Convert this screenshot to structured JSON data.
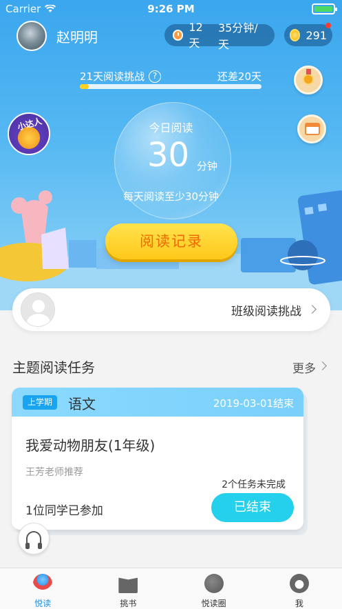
{
  "status_bar": {
    "carrier": "Carrier",
    "time": "9:26 PM"
  },
  "header": {
    "username": "赵明明",
    "streak_days": "12天",
    "daily_goal": "35分钟/天",
    "coins": "291"
  },
  "challenge": {
    "label": "21天阅读挑战",
    "help_symbol": "?",
    "remaining": "还差20天",
    "progress_fraction": 0.05
  },
  "mascot": {
    "text": "小达人"
  },
  "today": {
    "label": "今日阅读",
    "minutes": "30",
    "unit": "分钟",
    "hint": "每天阅读至少30分钟"
  },
  "record_button": "阅读记录",
  "class_challenge": {
    "label": "班级阅读挑战"
  },
  "section": {
    "title": "主题阅读任务",
    "more": "更多"
  },
  "task": {
    "term": "上学期",
    "subject": "语文",
    "end_date": "2019-03-01结束",
    "title": "我爱动物朋友(1年级)",
    "teacher": "王芳老师推荐",
    "incomplete": "2个任务未完成",
    "joined": "1位同学已参加",
    "status_button": "已结束"
  },
  "tabs": [
    {
      "label": "悦读",
      "icon": "ufo-icon",
      "active": true
    },
    {
      "label": "挑书",
      "icon": "book-icon",
      "active": false
    },
    {
      "label": "悦读圈",
      "icon": "planet-icon",
      "active": false
    },
    {
      "label": "我",
      "icon": "robot-icon",
      "active": false
    }
  ],
  "colors": {
    "sky": "#3aa6ee",
    "accent_yellow": "#ffc81a",
    "record_text": "#f06a00",
    "active_tab": "#1e8fe0",
    "finish_button": "#24d0ec"
  }
}
